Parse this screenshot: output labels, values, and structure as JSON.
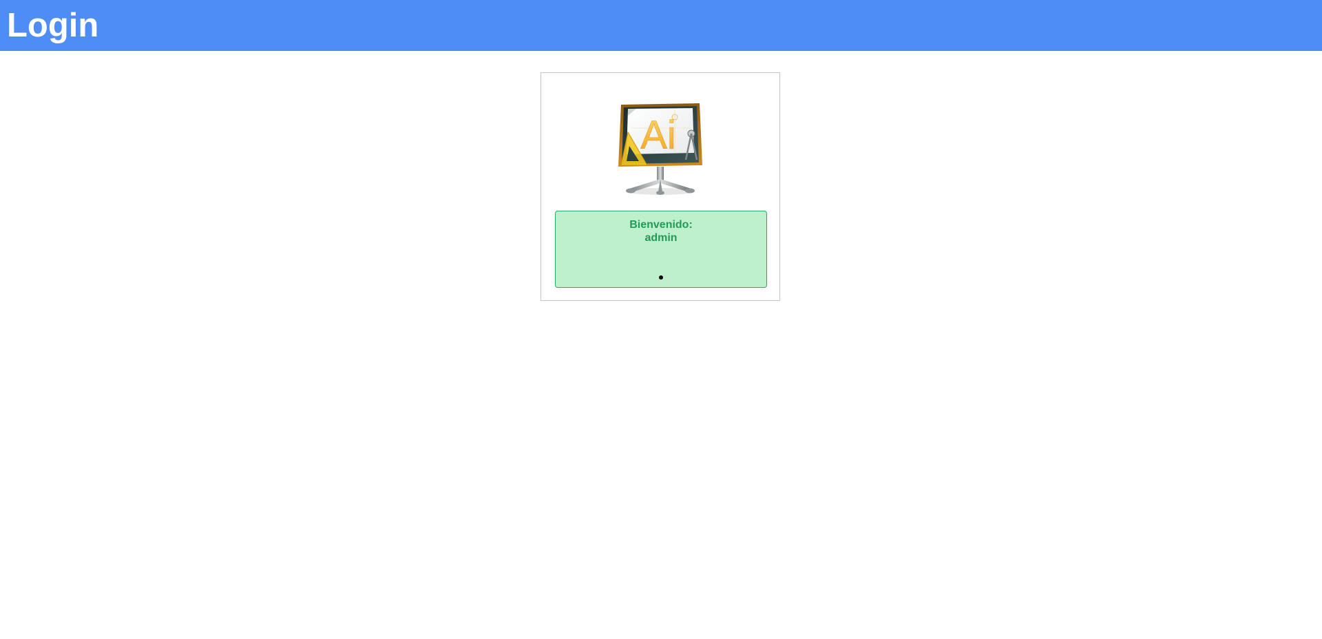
{
  "header": {
    "title": "Login"
  },
  "login": {
    "logo": {
      "icon": "drafting-board-logo-icon",
      "letters": "Ai"
    },
    "welcome": {
      "greeting": "Bienvenido:",
      "username": "admin"
    }
  },
  "colors": {
    "header_bg": "#4d8df4",
    "success_bg": "#bdf0cc",
    "success_border": "#2ea85f",
    "success_text": "#229b57"
  }
}
